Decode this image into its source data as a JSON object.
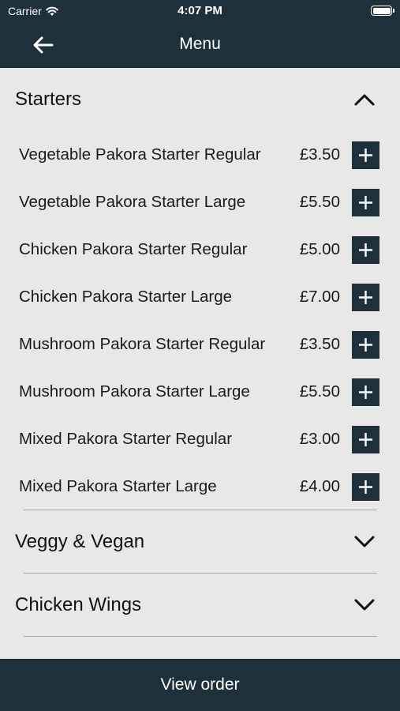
{
  "status_bar": {
    "carrier": "Carrier",
    "time": "4:07 PM"
  },
  "nav": {
    "title": "Menu"
  },
  "sections": [
    {
      "title": "Starters",
      "expanded": true,
      "items": [
        {
          "name": "Vegetable Pakora Starter Regular",
          "price": "£3.50"
        },
        {
          "name": "Vegetable Pakora Starter Large",
          "price": "£5.50"
        },
        {
          "name": "Chicken Pakora Starter Regular",
          "price": "£5.00"
        },
        {
          "name": "Chicken Pakora Starter Large",
          "price": "£7.00"
        },
        {
          "name": "Mushroom Pakora Starter Regular",
          "price": "£3.50"
        },
        {
          "name": "Mushroom Pakora Starter Large",
          "price": "£5.50"
        },
        {
          "name": "Mixed Pakora Starter Regular",
          "price": "£3.00"
        },
        {
          "name": "Mixed Pakora Starter Large",
          "price": "£4.00"
        }
      ]
    },
    {
      "title": "Veggy & Vegan",
      "expanded": false
    },
    {
      "title": "Chicken Wings",
      "expanded": false
    }
  ],
  "footer": {
    "view_order_label": "View order"
  },
  "colors": {
    "brand_dark": "#1e3039",
    "background": "#e8e8e8",
    "divider": "#a8a8a8"
  }
}
